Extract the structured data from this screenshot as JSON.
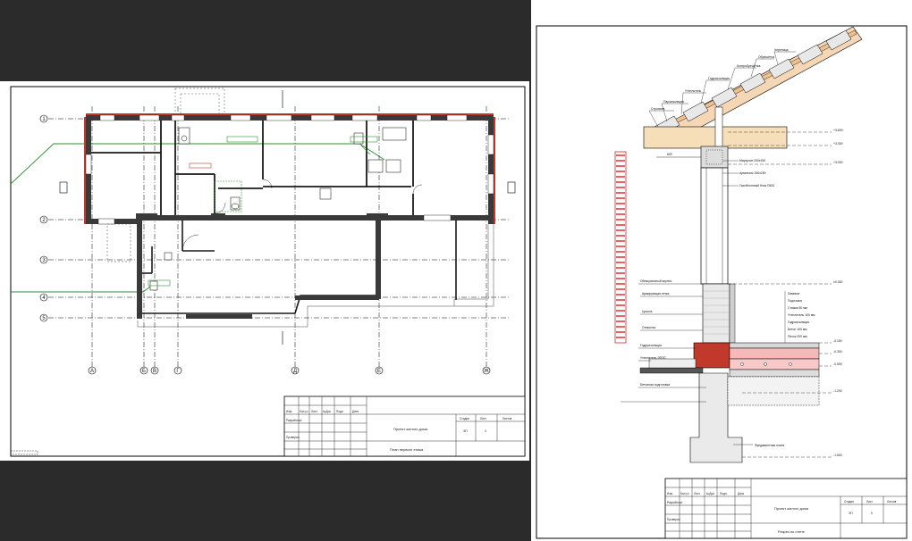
{
  "left_sheet": {
    "axes_rows": [
      "1",
      "2",
      "3",
      "4",
      "5"
    ],
    "axes_cols": [
      "A",
      "Б",
      "В",
      "Г",
      "Д",
      "Е",
      "Ж"
    ],
    "title_block": {
      "header_cols": [
        "Изм.",
        "Кол.уч",
        "Лист",
        "№Док",
        "Подп.",
        "Дата"
      ],
      "role_1": "Разработал",
      "role_2": "Проверил",
      "project_title": "Проект жилого дома",
      "sheet_title": "План первого этажа",
      "stage_label": "Стадия",
      "sheet_label": "Лист",
      "sheets_label": "Листов",
      "stage_value": "ЭП",
      "sheet_value": "3"
    }
  },
  "right_sheet": {
    "roof_labels": [
      "Черепица",
      "Обрешётка",
      "Контробрешётка",
      "Гидроизоляция",
      "Утеплитель",
      "Пароизоляция",
      "Стропила"
    ],
    "wall_labels": [
      "Мауэрлат 200х150",
      "Армопояс 250х250",
      "Газобетонный блок D500",
      "Облицовочный кирпич",
      "Армирующая сетка",
      "Цоколь",
      "Отмостка",
      "Гидроизоляция",
      "Утеплитель ЭППС",
      "Бетонная подготовка",
      "Фундаментная плита"
    ],
    "floor_layers": [
      "Ламинат",
      "Подложка",
      "Стяжка 50 мм",
      "Утеплитель 100 мм",
      "Гидроизоляция",
      "Бетон 100 мм",
      "Песок 200 мм"
    ],
    "levels": [
      "+3.600",
      "+3.300",
      "+3.000",
      "±0.000",
      "-0.150",
      "-0.300",
      "-0.500",
      "-1.200",
      "-1.500"
    ],
    "dimension": "600",
    "title_block": {
      "header_cols": [
        "Изм.",
        "Кол.уч",
        "Лист",
        "№Док",
        "Подп.",
        "Дата"
      ],
      "role_1": "Разработал",
      "role_2": "Проверил",
      "project_title": "Проект жилого дома",
      "sheet_title": "Разрез по стене",
      "stage_label": "Стадия",
      "sheet_label": "Лист",
      "sheets_label": "Листов",
      "stage_value": "ЭП",
      "sheet_value": "5"
    }
  }
}
